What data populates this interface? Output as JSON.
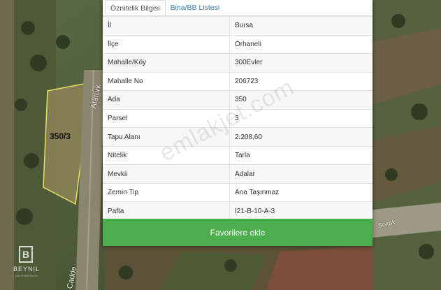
{
  "tabs": [
    {
      "label": "Öznitelik Bilgisi",
      "active": true
    },
    {
      "label": "Bina/BB Listesi",
      "active": false
    }
  ],
  "rows": [
    {
      "key": "İl",
      "value": "Bursa"
    },
    {
      "key": "İlçe",
      "value": "Orhaneli"
    },
    {
      "key": "Mahalle/Köy",
      "value": "300Evler"
    },
    {
      "key": "Mahalle No",
      "value": "206723"
    },
    {
      "key": "Ada",
      "value": "350"
    },
    {
      "key": "Parsel",
      "value": "3"
    },
    {
      "key": "Tapu Alanı",
      "value": "2.208,60"
    },
    {
      "key": "Nitelik",
      "value": "Tarla"
    },
    {
      "key": "Mevkii",
      "value": "Adalar"
    },
    {
      "key": "Zemin Tip",
      "value": "Ana Taşınmaz"
    },
    {
      "key": "Pafta",
      "value": "I21-B-10-A-3"
    }
  ],
  "favorite_button": "Favorilere ekle",
  "map": {
    "parcel_label": "350/3",
    "road_label_top": "Atatürk",
    "road_label_bottom": "Cadde",
    "street_label": "Sokak"
  },
  "watermark": "emlakjet.com",
  "logo": {
    "letter": "B",
    "name": "BEYNIL",
    "sub": "GAYRİMENKUL"
  },
  "colors": {
    "accent_green": "#4cae4c",
    "link_blue": "#337ab7"
  }
}
